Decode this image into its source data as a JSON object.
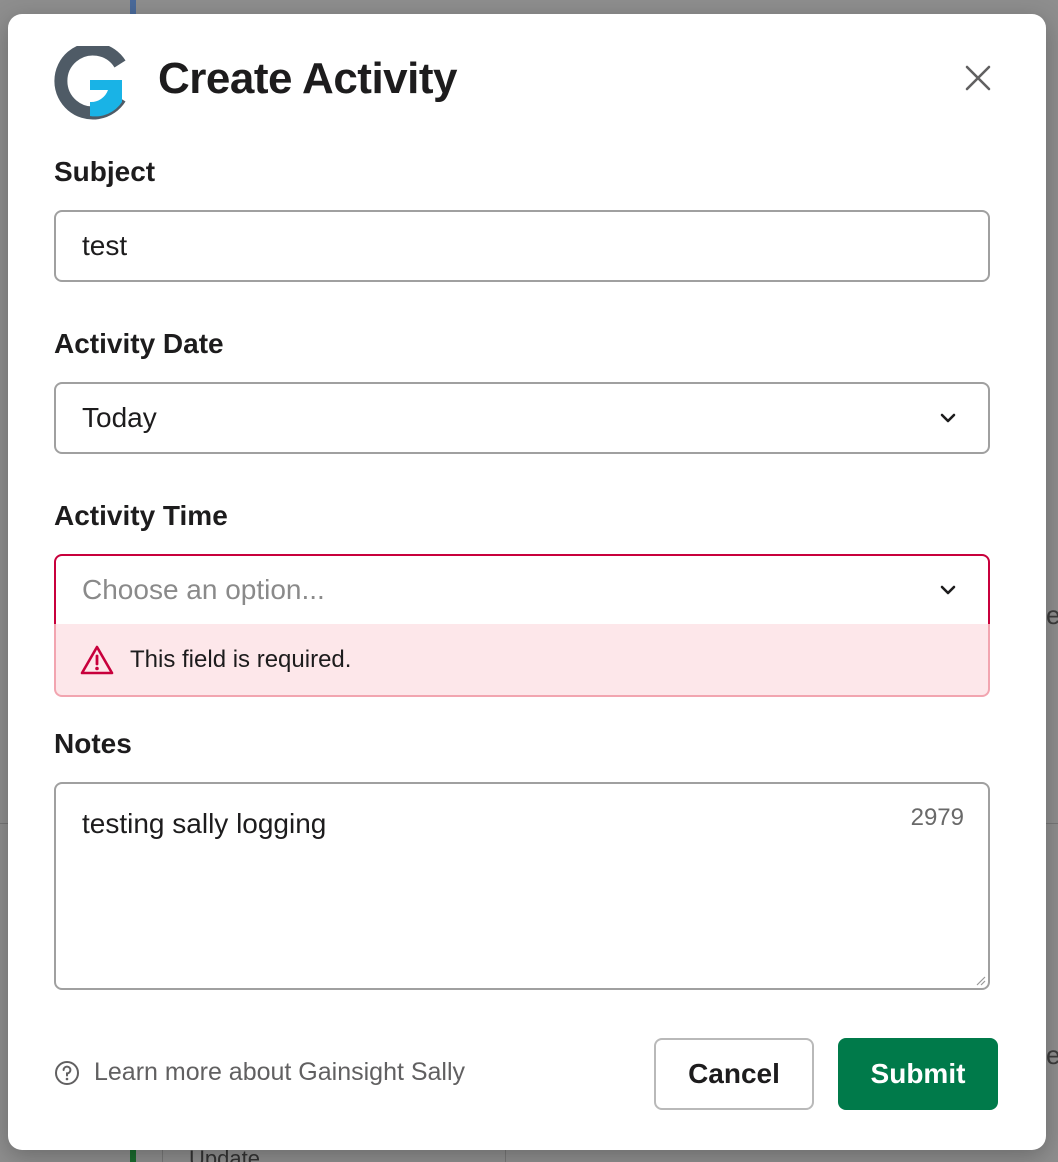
{
  "background": {
    "fragment_1": "e",
    "fragment_2": "e",
    "update_text": "Update"
  },
  "modal": {
    "title": "Create Activity",
    "logo_letter": "G",
    "close_icon": "close-icon"
  },
  "form": {
    "subject": {
      "label": "Subject",
      "value": "test"
    },
    "activity_date": {
      "label": "Activity Date",
      "value": "Today"
    },
    "activity_time": {
      "label": "Activity Time",
      "placeholder": "Choose an option...",
      "error": "This field is required."
    },
    "notes": {
      "label": "Notes",
      "value": "testing sally logging",
      "counter": "2979"
    }
  },
  "footer": {
    "learn_more": "Learn more about Gainsight Sally",
    "cancel_label": "Cancel",
    "submit_label": "Submit"
  },
  "colors": {
    "submit": "#007a4a",
    "error_border": "#c8003c",
    "error_bg": "#fde7ea",
    "logo_gray": "#4f5b66",
    "logo_blue": "#19b3e6"
  }
}
